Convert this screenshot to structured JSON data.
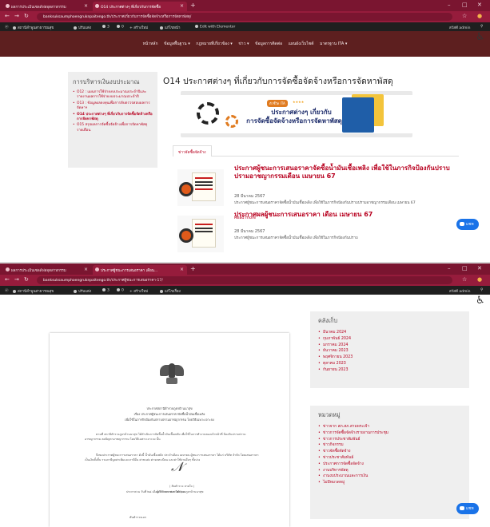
{
  "colors": {
    "browser_frame": "#961c3c",
    "site_nav": "#5d1f1f",
    "link": "#b8001f",
    "chat_button": "#1a73e8"
  },
  "screenshot1": {
    "tabs": [
      {
        "label": "ผลการประเมินเซลล์ฟสอุตสาหกรรม",
        "active": false
      },
      {
        "label": "O14 ประกาศต่างๆ ที่เกี่ยวกับการจัดซื้อ",
        "active": true
      }
    ],
    "url": {
      "domain": "banksuksaumphoengruknpaitengo.th",
      "path": "/ประกาศเกี่ยวกับการจัดซื้อจัดจ้างหรือการจัดหาพัสดุ/"
    },
    "bookmarks": [
      "สถานีลำพูนสาธารณสุข",
      "ปรับแต่ง",
      "3",
      "0",
      "สร้างใหม่",
      "แก้ไขหน้า",
      "Edit with Elementor",
      "สวัสดี admin"
    ],
    "site_nav": [
      "หน้าหลัก",
      "ข้อมูลพื้นฐาน ▾",
      "กฎหมายที่เกี่ยวข้อง ▾",
      "ข่าว ▾",
      "ข้อมูลการติดต่อ",
      "แผนผังเว็บไซต์",
      "มาตรฐาน ITA ▾"
    ],
    "sidebar": {
      "title": "การบริหารเงินงบประมาณ",
      "items": [
        {
          "label": "O12 : แผนการใช้จ่ายงบประมาณประจำปีและรายงานผลการใช้จ่ายงบประมาณประจำปี",
          "current": false
        },
        {
          "label": "O13 : ข้อมูลผลลงทุนเพื่อการลับตรวจสอบผลการจัดหาฯ",
          "current": false
        },
        {
          "label": "O14 ประกาศต่างๆ ที่เกี่ยวกับการจัดซื้อจัดจ้างหรือการจัดหาพัสดุ",
          "current": true
        },
        {
          "label": "O15 สรุปผลการจัดซื้อจัดจ้างเพื่อการจัดหาพัสดุรายเดือน",
          "current": false
        }
      ]
    },
    "heading": "O14 ประกาศต่างๆ ที่เกี่ยวกับการจัดซื้อจัดจ้างหรือการจัดหาพัสดุ",
    "banner": {
      "badge": "ตัวชี้วัด ITA",
      "stars": "★★★★",
      "line1": "ประกาศต่างๆ เกี่ยวกับ",
      "line2": "การจัดซื้อจัดจ้างหรือการจัดหาพัสดุ"
    },
    "tab_label": "ข่าวจัดซื้อจัดจ้าง",
    "posts": [
      {
        "title": "ประกาศผู้ชนะการเสนอราคาจัดซื้อน้ำมันเชื้อเพลิง เพื่อใช้ในภารกิจป้องกันปราบปรามอาชญากรรมเดือน เมษายน 67",
        "date": "28 มีนาคม 2567",
        "excerpt": "ประกาศผู้ชนะการเสนอราคาจัดซื้อน้ำมันเชื้อเพลิง เพื่อใช้ในภารกิจป้องกันปราบปรามอาชญากรรมเดือน เมษายน 67",
        "more": "Read more"
      },
      {
        "title": "ประกาศผลผู้ชนะการเสนอราคา เดือน เมษายน 67",
        "date": "28 มีนาคม 2567",
        "excerpt": "ประกาศผู้ชนะการเสนอราคาจัดซื้อน้ำมันเชื้อเพลิง เพื่อใช้ในภารกิจป้องกันปราบ",
        "more": ""
      }
    ],
    "chat": "แชท"
  },
  "screenshot2": {
    "tabs": [
      {
        "label": "ผลการประเมินเซลล์ฟสอุตสาหกรรม",
        "active": false
      },
      {
        "label": "ประกาศผู้ชนะการเสนอราคา เดือน...",
        "active": true
      }
    ],
    "url": {
      "domain": "banksuksaumphoengruknpaitengo.th",
      "path": "/ประกาศผู้ชนะการเสนอราคา-17/"
    },
    "bookmarks": [
      "สถานีลำพูนสาธารณสุข",
      "ปรับแต่ง",
      "3",
      "0",
      "สร้างใหม่",
      "แก้ไขเรื่อง",
      "สวัสดี admin"
    ],
    "document": {
      "header1": "ประกาศสถานีตำรวจภูธรบ้านนาสุข",
      "header2": "เรื่อง ประกาศผู้ชนะการเสนอราคาจัดซื้อน้ำมันเชื้อเพลิง",
      "header3": "เพื่อใช้ในภารกิจป้องกันปราบปรามอาชญากรรม โดยวิธีเฉพาะเจาะจง",
      "para1": "ตามที่ สถานีตำรวจภูธรบ้านนาสุข ได้ดำเนินการจัดซื้อน้ำมันเชื้อเพลิง เพื่อใช้ในการทำงานของเจ้าหน้าที่ ป้องกันปราบปรามอาชญากรรม ลดปัญหาอาชญากรรม โดยวิธีเฉพาะเจาะจง นั้น",
      "para2": "จึงขอประกาศผู้ชนะการเสนอราคา ดังนี้ น้ำมันเชื้อเพลิง ประจำเดือน เมษายน ผู้ชนะการเสนอราคา ได้แก่ บริษัท จำกัด โดยเสนอราคาเป็นเงินทั้งสิ้น รวมภาษีมูลค่าเพิ่มและภาษีอื่น ค่าขนส่ง ค่าจดทะเบียน และค่าใช้จ่ายอื่นๆ ทั้งปวง",
      "date_line": "ประกาศ ณ วันที่ ๒๘ เดือน มีนาคม พ.ศ. ๒๕๖๗",
      "sign_name": "( สิบตำรวจ สายใจ )",
      "sign_role": "ผู้กำกับการสถานีตำรวจภูธรบ้านนาสุข",
      "sign_pre": "พันตำรวจเอก"
    },
    "archive": {
      "title": "คลังเก็บ",
      "items": [
        "มีนาคม 2024",
        "กุมภาพันธ์ 2024",
        "มกราคม 2024",
        "ธันวาคม 2023",
        "พฤศจิกายน 2023",
        "ตุลาคม 2023",
        "กันยายน 2023"
      ]
    },
    "categories": {
      "title": "หมวดหมู่",
      "items": [
        "ข่าวจาก สภ.สภ.สามพระเจ้า",
        "ข่าวการจัดซื้อจัดจ้างรายงานการประชุม",
        "ข่าวการประชาสัมพันธ์",
        "ข่าวกิจกรรม",
        "ข่าวจัดซื้อจัดจ้าง",
        "ข่าวประชาสัมพันธ์",
        "ประกาศการจัดซื้อจัดจ้าง",
        "งานบริหารพัสดุ",
        "งานงบประมาณและการเงิน",
        "ไม่มีหมวดหมู่"
      ]
    },
    "chat": "แชท"
  }
}
